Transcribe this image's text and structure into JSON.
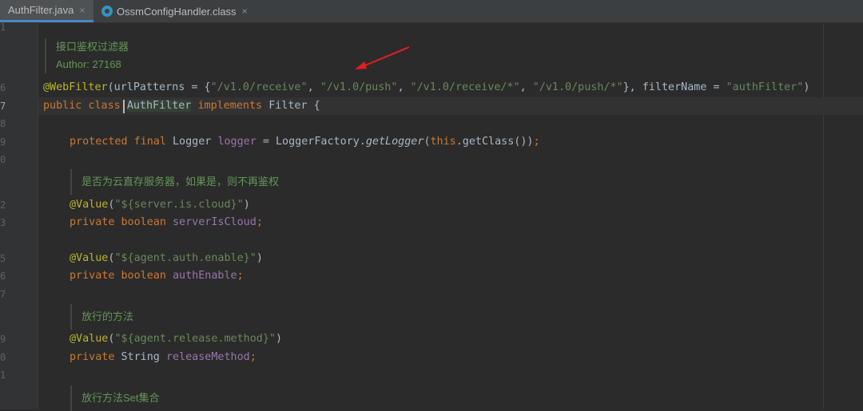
{
  "tabs": [
    {
      "label": "AuthFilter.java",
      "close": "×",
      "active": true
    },
    {
      "label": "OssmConfigHandler.class",
      "close": "×",
      "active": false
    }
  ],
  "gutter": {
    "line_numbers": [
      "1",
      "6",
      "7",
      "8",
      "9",
      "0",
      "2",
      "3",
      "5",
      "6",
      "7",
      "9",
      "0",
      "1"
    ]
  },
  "docs": {
    "class_doc": {
      "title": "接口鉴权过滤器",
      "author": "Author: 27168"
    },
    "cloud_doc": "是否为云直存服务器，如果是，则不再鉴权",
    "release_method_doc": "放行的方法",
    "release_set_doc": "放行方法Set集合"
  },
  "code": {
    "webfilter": {
      "annotation": "@WebFilter",
      "open": "(urlPatterns = {",
      "p1": "\"/v1.0/receive\"",
      "sep1": ", ",
      "p2": "\"/v1.0/push\"",
      "sep2": ", ",
      "p3": "\"/v1.0/receive/*\"",
      "sep3": ", ",
      "p4": "\"/v1.0/push/*\"",
      "mid": "}, filterName = ",
      "name": "\"authFilter\"",
      "close": ")"
    },
    "class_decl": {
      "mods": "public class ",
      "name": "AuthFilter",
      "impl": " implements ",
      "iface": "Filter {"
    },
    "logger": {
      "mods": "protected final ",
      "type": "Logger ",
      "field": "logger",
      "eq": " = LoggerFactory.",
      "method": "getLogger",
      "open": "(",
      "this_kw": "this",
      "rest": ".getClass())",
      "semi": ";"
    },
    "cloud_value": {
      "ann": "@Value",
      "open": "(",
      "str": "\"${server.is.cloud}\"",
      "close": ")"
    },
    "cloud_field": {
      "mods": "private boolean ",
      "field": "serverIsCloud",
      "semi": ";"
    },
    "auth_value": {
      "ann": "@Value",
      "open": "(",
      "str": "\"${agent.auth.enable}\"",
      "close": ")"
    },
    "auth_field": {
      "mods": "private boolean ",
      "field": "authEnable",
      "semi": ";"
    },
    "release_value": {
      "ann": "@Value",
      "open": "(",
      "str": "\"${agent.release.method}\"",
      "close": ")"
    },
    "release_field": {
      "mods": "private ",
      "type": "String ",
      "field": "releaseMethod",
      "semi": ";"
    }
  },
  "colors": {
    "background": "#2b2b2b",
    "keyword": "#cc7832",
    "annotation": "#bbb529",
    "string": "#6a8759",
    "field": "#9876aa",
    "doc": "#629755",
    "arrow": "#e02020"
  }
}
